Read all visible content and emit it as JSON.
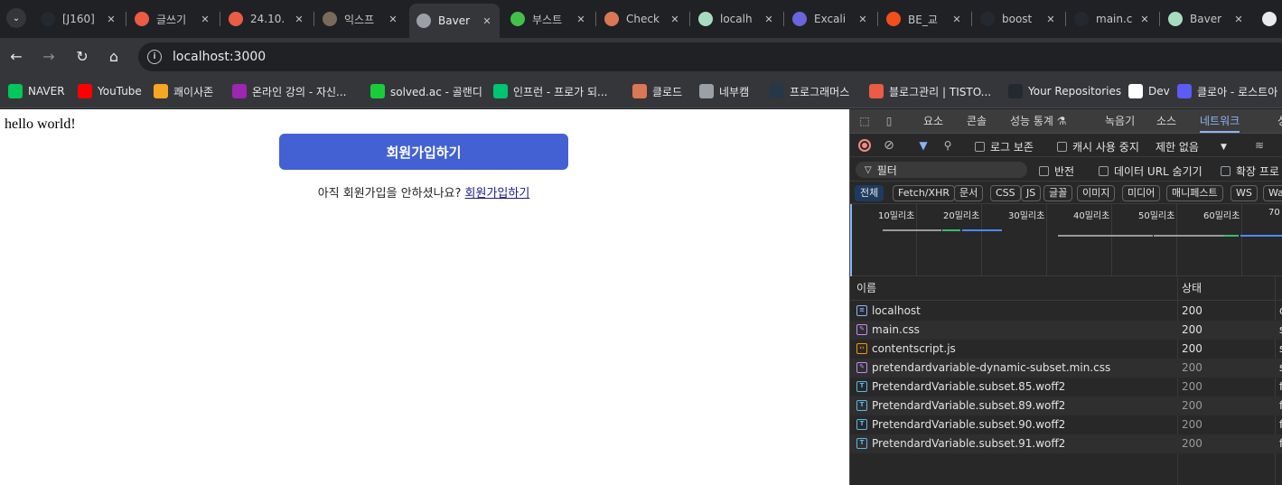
{
  "tabs": [
    {
      "title": "[J160]",
      "icon": "github-icon",
      "color": "#24292f"
    },
    {
      "title": "글쓰기",
      "icon": "tistory-icon",
      "color": "#eb5b46"
    },
    {
      "title": "24.10.",
      "icon": "tistory-icon",
      "color": "#eb5b46"
    },
    {
      "title": "익스프",
      "icon": "image-icon",
      "color": "#7a6a5a"
    },
    {
      "title": "Baver",
      "icon": "globe-icon",
      "color": "#9aa0a6",
      "active": true
    },
    {
      "title": "부스트",
      "icon": "boostcamp-icon",
      "color": "#44c04a"
    },
    {
      "title": "Check",
      "icon": "claude-icon",
      "color": "#d97757"
    },
    {
      "title": "localh",
      "icon": "page-b-icon",
      "color": "#a8dcc0"
    },
    {
      "title": "Excali",
      "icon": "excalidraw-icon",
      "color": "#6965db"
    },
    {
      "title": "BE_교",
      "icon": "figma-icon",
      "color": "#f24e1e"
    },
    {
      "title": "boost",
      "icon": "github-icon",
      "color": "#24292f"
    },
    {
      "title": "main.c",
      "icon": "github-icon",
      "color": "#24292f"
    },
    {
      "title": "Baver",
      "icon": "page-b-icon",
      "color": "#a8dcc0"
    }
  ],
  "address": {
    "url": "localhost:3000"
  },
  "bookmarks": [
    {
      "label": "NAVER",
      "icon": "naver-icon",
      "color": "#03c75a"
    },
    {
      "label": "YouTube",
      "icon": "youtube-icon",
      "color": "#ff0000"
    },
    {
      "label": "쾌이사존",
      "icon": "quasarzone-icon",
      "color": "#f5a623"
    },
    {
      "label": "온라인 강의 - 자신...",
      "icon": "inflearn-icon",
      "color": "#9c27b0"
    },
    {
      "label": "solved.ac - 골랜디",
      "icon": "solvedac-icon",
      "color": "#17ce3a"
    },
    {
      "label": "인프런 - 프로가 되...",
      "icon": "inflearn-q-icon",
      "color": "#00c471"
    },
    {
      "label": "클로드",
      "icon": "claude-icon",
      "color": "#d97757"
    },
    {
      "label": "네부캠",
      "icon": "folder-icon",
      "color": "#9aa0a6"
    },
    {
      "label": "프로그래머스",
      "icon": "programmers-icon",
      "color": "#263747"
    },
    {
      "label": "블로그관리 | TISTO...",
      "icon": "tistory-icon",
      "color": "#eb5b46"
    },
    {
      "label": "Your Repositories",
      "icon": "github-icon",
      "color": "#24292f"
    },
    {
      "label": "Dev",
      "icon": "openai-icon",
      "color": "#ffffff"
    },
    {
      "label": "클로아 - 로스트아",
      "icon": "kloa-icon",
      "color": "#5b5bf7"
    }
  ],
  "page": {
    "hello": "hello world!",
    "signup_button": "회원가입하기",
    "note_text": "아직 회원가입을 안하셨나요?",
    "note_link": "회원가입하기"
  },
  "devtools": {
    "tabs": [
      "요소",
      "콘솔",
      "성능 통계 ⚗",
      "녹음기",
      "소스",
      "네트워크",
      "성"
    ],
    "active_tab": "네트워크",
    "preserve_log": "로그 보존",
    "disable_cache": "캐시 사용 중지",
    "throttle": "제한 없음",
    "filter_placeholder": "필터",
    "invert": "반전",
    "hide_data_urls": "데이터 URL 숨기기",
    "extension": "확장 프로",
    "type_chips": [
      "전체",
      "Fetch/XHR",
      "문서",
      "CSS",
      "JS",
      "글꼴",
      "이미지",
      "미디어",
      "매니페스트",
      "WS",
      "Was"
    ],
    "timeline_labels": [
      "10밀리초",
      "20밀리초",
      "30밀리초",
      "40밀리초",
      "50밀리초",
      "60밀리초",
      "70"
    ],
    "columns": {
      "name": "이름",
      "status": "상태"
    },
    "requests": [
      {
        "name": "localhost",
        "status": "200",
        "type": "d",
        "kind": "doc",
        "dim": false
      },
      {
        "name": "main.css",
        "status": "200",
        "type": "s",
        "kind": "css",
        "dim": false
      },
      {
        "name": "contentscript.js",
        "status": "200",
        "type": "s",
        "kind": "js",
        "dim": false
      },
      {
        "name": "pretendardvariable-dynamic-subset.min.css",
        "status": "200",
        "type": "s",
        "kind": "css",
        "dim": true
      },
      {
        "name": "PretendardVariable.subset.85.woff2",
        "status": "200",
        "type": "f",
        "kind": "font",
        "dim": true
      },
      {
        "name": "PretendardVariable.subset.89.woff2",
        "status": "200",
        "type": "f",
        "kind": "font",
        "dim": true
      },
      {
        "name": "PretendardVariable.subset.90.woff2",
        "status": "200",
        "type": "f",
        "kind": "font",
        "dim": true
      },
      {
        "name": "PretendardVariable.subset.91.woff2",
        "status": "200",
        "type": "f",
        "kind": "font",
        "dim": true
      }
    ]
  }
}
